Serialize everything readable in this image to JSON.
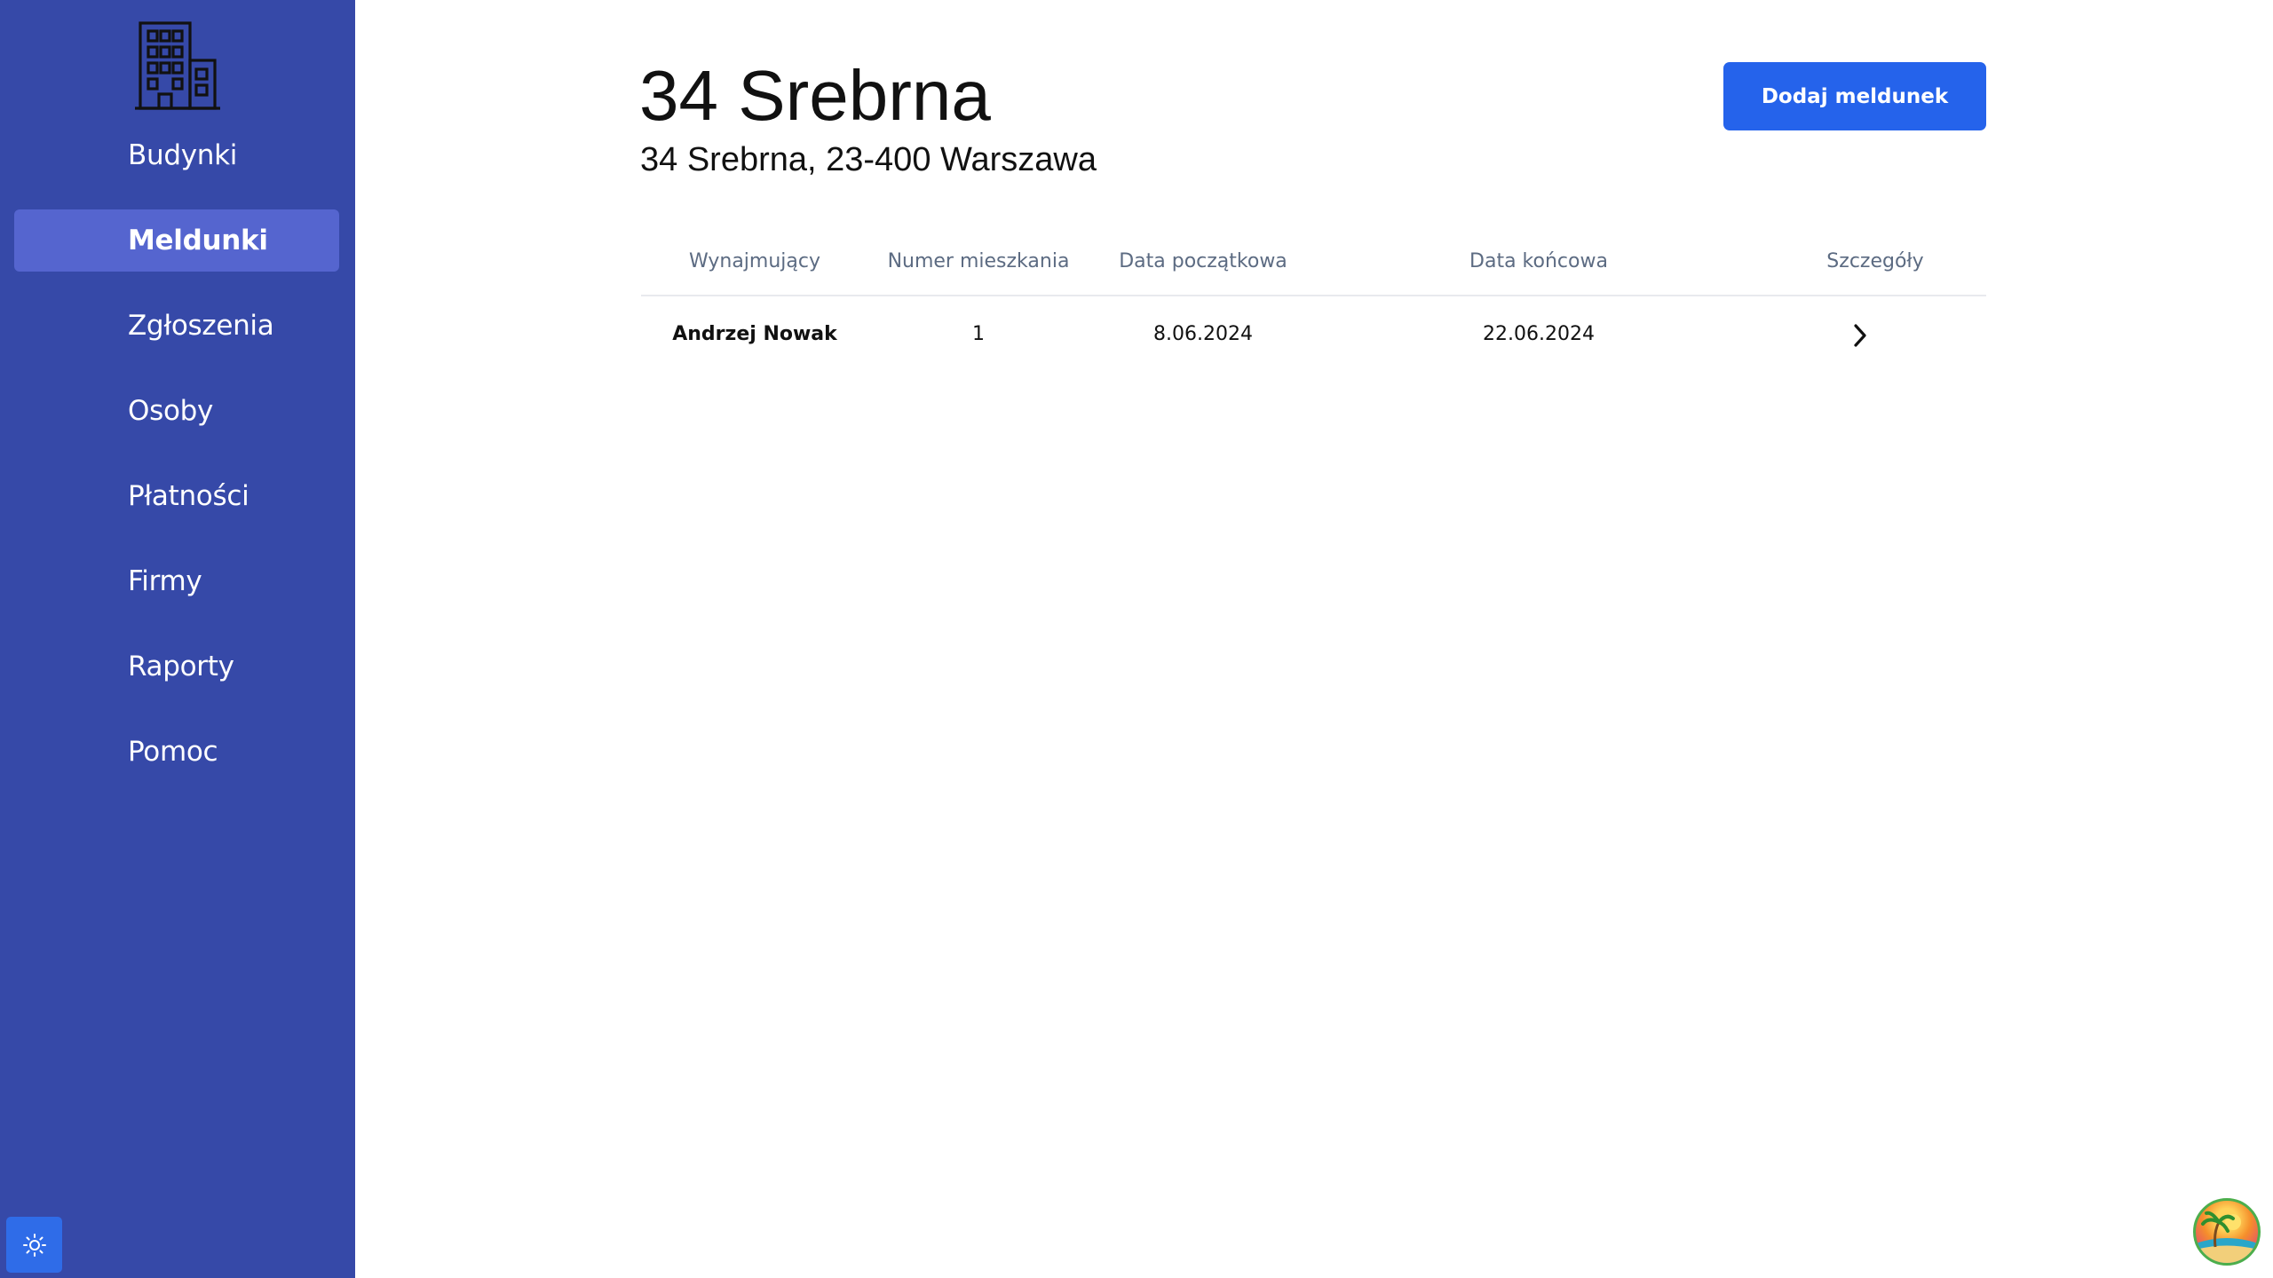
{
  "sidebar": {
    "logo_icon": "building-icon",
    "items": [
      {
        "label": "Budynki",
        "active": false
      },
      {
        "label": "Meldunki",
        "active": true
      },
      {
        "label": "Zgłoszenia",
        "active": false
      },
      {
        "label": "Osoby",
        "active": false
      },
      {
        "label": "Płatności",
        "active": false
      },
      {
        "label": "Firmy",
        "active": false
      },
      {
        "label": "Raporty",
        "active": false
      },
      {
        "label": "Pomoc",
        "active": false
      }
    ],
    "theme_toggle_icon": "sun-icon"
  },
  "header": {
    "title": "34 Srebrna",
    "subtitle": "34 Srebrna, 23-400 Warszawa",
    "add_button_label": "Dodaj meldunek"
  },
  "table": {
    "columns": [
      "Wynajmujący",
      "Numer mieszkania",
      "Data początkowa",
      "Data końcowa",
      "Szczegóły"
    ],
    "rows": [
      {
        "tenant": "Andrzej Nowak",
        "apartment": "1",
        "start_date": "8.06.2024",
        "end_date": "22.06.2024",
        "details_icon": "chevron-right-icon"
      }
    ]
  },
  "colors": {
    "sidebar_bg": "#3649a8",
    "sidebar_active_bg": "#5565cf",
    "primary_button": "#2563eb"
  },
  "avatar_icon": "beach-avatar-icon"
}
